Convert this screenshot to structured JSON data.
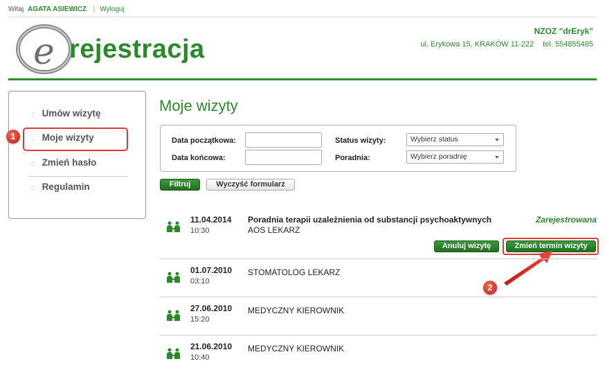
{
  "topbar": {
    "greeting": "Witaj",
    "username": "AGATA ASIEWICZ",
    "separator": "|",
    "logout": "Wyloguj"
  },
  "logo": {
    "letter": "e",
    "text": "rejestracja"
  },
  "clinic": {
    "name": "NZOZ \"drEryk\"",
    "address": "ul. Erykowa 15, KRAKÓW 11-222",
    "phone": "tel. 554855485"
  },
  "sidebar": {
    "items": [
      {
        "bullet": "::",
        "label": "Umów wizytę"
      },
      {
        "bullet": "::",
        "label": "Moje wizyty"
      },
      {
        "bullet": "::",
        "label": "Zmień hasło"
      },
      {
        "bullet": "::",
        "label": "Regulamin"
      }
    ],
    "active_index": 1
  },
  "annotations": {
    "badge1": "1",
    "badge2": "2"
  },
  "page": {
    "title": "Moje wizyty"
  },
  "filter": {
    "start_date_label": "Data początkowa:",
    "start_date_value": "",
    "end_date_label": "Data końcowa:",
    "end_date_value": "",
    "status_label": "Status wizyty:",
    "status_selected": "Wybierz status",
    "clinic_label": "Poradnia:",
    "clinic_selected": "Wybierz poradnię",
    "filter_button": "Filtruj",
    "clear_button": "Wyczyść formularz"
  },
  "visits": [
    {
      "date": "11.04.2014",
      "time": "10:30",
      "title": "Poradnia terapii uzależnienia od substancji psychoaktywnych",
      "doctor": "AOS LEKARZ",
      "status": "Zarejestrowana",
      "cancel_label": "Anuluj wizytę",
      "change_label": "Zmień termin wizyty"
    },
    {
      "date": "01.07.2010",
      "time": "03:10",
      "title": "",
      "doctor": "STOMATOLOG LEKARZ"
    },
    {
      "date": "27.06.2010",
      "time": "15:20",
      "title": "",
      "doctor": "MEDYCZNY KIEROWNIK"
    },
    {
      "date": "21.06.2010",
      "time": "10:40",
      "title": "",
      "doctor": "MEDYCZNY KIEROWNIK"
    }
  ],
  "colors": {
    "brand_green": "#2a8a2a",
    "highlight_red": "#e23a3a"
  }
}
